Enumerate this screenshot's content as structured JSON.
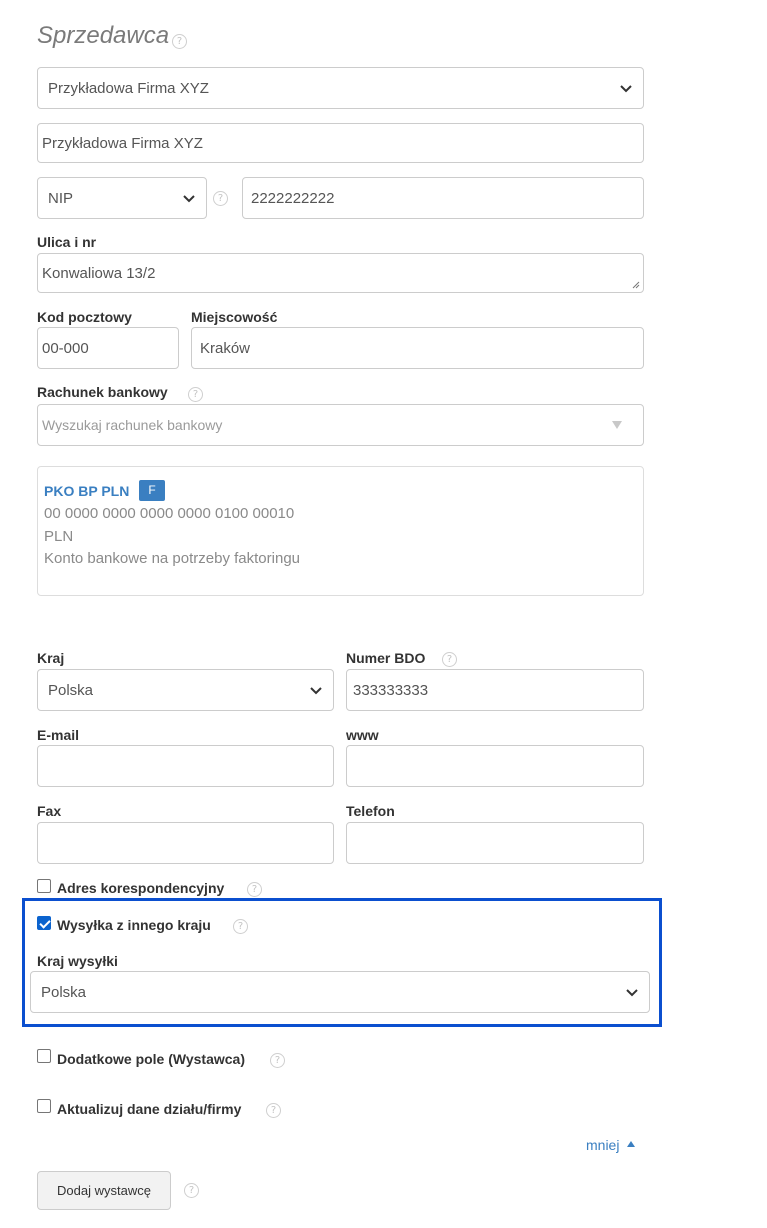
{
  "seller": {
    "title": "Sprzedawca",
    "help_glyph": "?",
    "company_select": "Przykładowa Firma XYZ",
    "company_name": "Przykładowa Firma XYZ",
    "tax_id_type": "NIP",
    "tax_id_value": "2222222222",
    "street_label": "Ulica i nr",
    "street_value": "Konwaliowa 13/2",
    "postal_label": "Kod pocztowy",
    "postal_value": "00-000",
    "city_label": "Miejscowość",
    "city_value": "Kraków",
    "bank_label": "Rachunek bankowy",
    "bank_search_placeholder": "Wyszukaj rachunek bankowy",
    "bank_account": {
      "name": "PKO BP PLN",
      "badge": "F",
      "number": "00 0000 0000 0000 0000 0100 00010",
      "currency": "PLN",
      "description": "Konto bankowe na potrzeby faktoringu"
    },
    "country_label": "Kraj",
    "country_value": "Polska",
    "bdo_label": "Numer BDO",
    "bdo_value": "333333333",
    "email_label": "E-mail",
    "email_value": "",
    "www_label": "www",
    "www_value": "",
    "fax_label": "Fax",
    "fax_value": "",
    "phone_label": "Telefon",
    "phone_value": "",
    "correspondence_label": "Adres korespondencyjny",
    "correspondence_checked": false,
    "ship_other_country_label": "Wysyłka z innego kraju",
    "ship_other_country_checked": true,
    "ship_country_label": "Kraj wysyłki",
    "ship_country_value": "Polska",
    "extra_field_label": "Dodatkowe pole (Wystawca)",
    "extra_field_checked": false,
    "update_label": "Aktualizuj dane działu/firmy",
    "update_checked": false,
    "less_link": "mniej",
    "add_button": "Dodaj wystawcę"
  },
  "colors": {
    "link": "#3a7fc1",
    "highlight_border": "#0b4fcf",
    "checkbox_checked": "#0b63ce"
  }
}
